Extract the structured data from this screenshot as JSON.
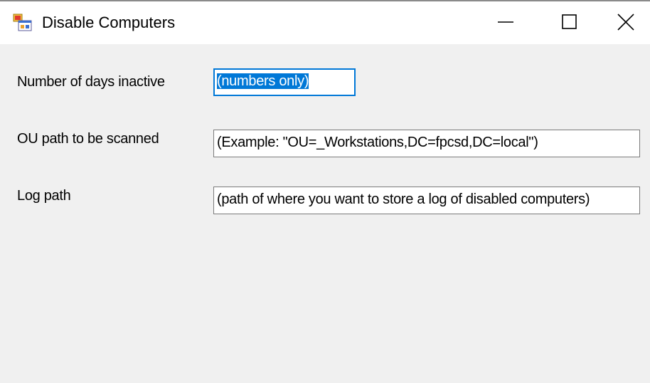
{
  "window": {
    "title": "Disable Computers",
    "icon": "form-app-icon",
    "minimize_icon": "minimize-icon",
    "maximize_icon": "maximize-icon",
    "close_icon": "close-icon"
  },
  "form": {
    "days_inactive": {
      "label": "Number of days inactive",
      "value": "(numbers only)",
      "selected": true
    },
    "ou_path": {
      "label": "OU path to be scanned",
      "value": "(Example: \"OU=_Workstations,DC=fpcsd,DC=local\")"
    },
    "log_path": {
      "label": "Log path",
      "value": "(path of where you want to store a log of disabled computers)"
    }
  },
  "colors": {
    "window_bg": "#f0f0f0",
    "titlebar_bg": "#ffffff",
    "focus_border": "#0078d7",
    "selection_bg": "#0078d7"
  }
}
